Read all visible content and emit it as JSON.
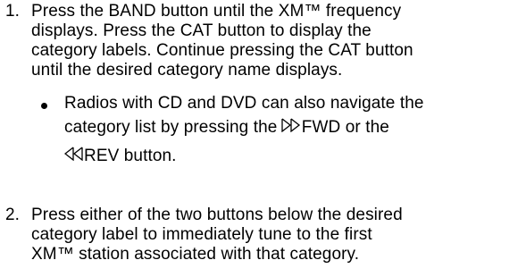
{
  "steps": [
    {
      "number": "1.",
      "lines": [
        "Press the BAND button until the XM™ frequency",
        "displays. Press the CAT button to display the",
        "category labels. Continue pressing the CAT button",
        "until the desired category name displays."
      ]
    },
    {
      "number": "2.",
      "lines": [
        "Press either of the two buttons below the desired",
        "category label to immediately tune to the first",
        "XM™ station associated with that category."
      ]
    }
  ],
  "bullet": {
    "line1": "Radios with CD and DVD can also navigate the",
    "line2_before": "category list by pressing the ",
    "fwd_icon": "fast-forward-icon",
    "fwd_label": "FWD",
    "line2_after": " or the",
    "rev_icon": "rewind-icon",
    "rev_label": "REV",
    "line3_after": " button."
  }
}
